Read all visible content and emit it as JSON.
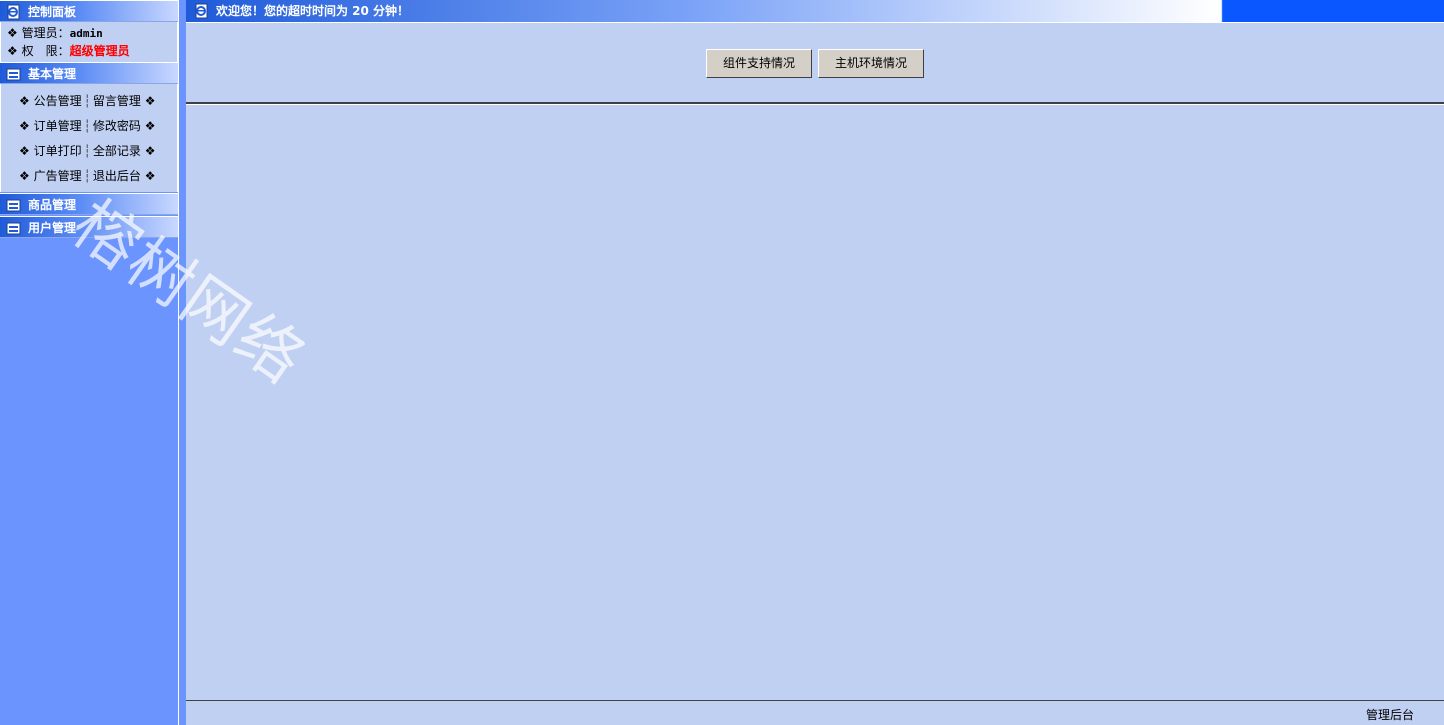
{
  "sidebar": {
    "control_panel": {
      "title": "控制面板",
      "admin_label": "管理员：",
      "admin_value": "admin",
      "role_label": "权　限：",
      "role_value": "超级管理员"
    },
    "basic": {
      "title": "基本管理",
      "rows": [
        {
          "left": "公告管理",
          "right": "留言管理"
        },
        {
          "left": "订单管理",
          "right": "修改密码"
        },
        {
          "left": "订单打印",
          "right": "全部记录"
        },
        {
          "left": "广告管理",
          "right": "退出后台"
        }
      ]
    },
    "goods": {
      "title": "商品管理"
    },
    "users": {
      "title": "用户管理"
    },
    "bullet": "❖",
    "separator": "┆"
  },
  "header": {
    "welcome": "欢迎您！您的超时时间为 20 分钟！"
  },
  "toolbar": {
    "component_button": "组件支持情况",
    "host_button": "主机环境情况"
  },
  "footer": {
    "text": "管理后台"
  },
  "watermark": "榕树网络",
  "colors": {
    "sidebar_bg": "#6b94fe",
    "main_bg": "#c0d0f2",
    "role_red": "#ff0000",
    "header_blue": "#1f5bd9"
  }
}
